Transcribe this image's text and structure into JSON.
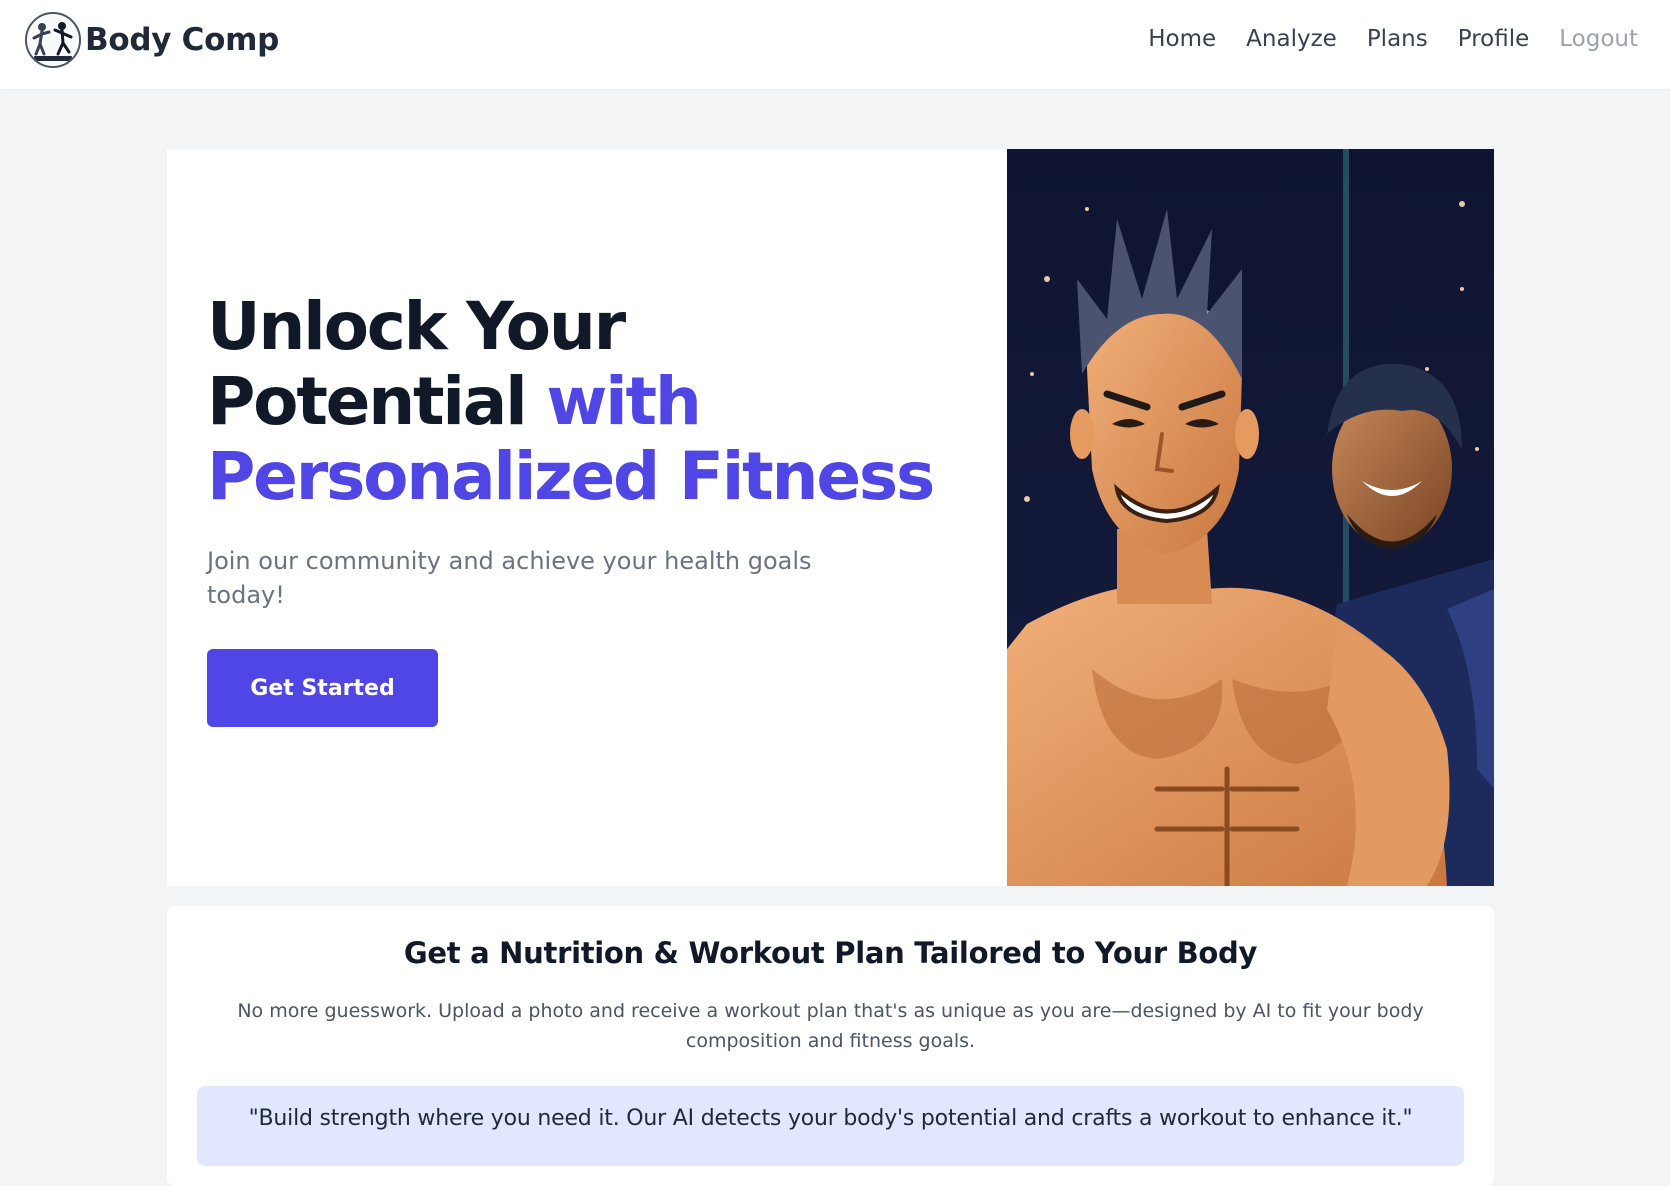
{
  "header": {
    "brand": "Body Comp",
    "nav": [
      {
        "label": "Home"
      },
      {
        "label": "Analyze"
      },
      {
        "label": "Plans"
      },
      {
        "label": "Profile"
      },
      {
        "label": "Logout"
      }
    ]
  },
  "hero": {
    "title_line1": "Unlock Your",
    "title_line2": "Potential",
    "title_accent1": "with",
    "title_accent2": "Personalized Fitness",
    "subtitle": "Join our community and achieve your health goals today!",
    "cta_label": "Get Started"
  },
  "features": {
    "title": "Get a Nutrition & Workout Plan Tailored to Your Body",
    "description": "No more guesswork. Upload a photo and receive a workout plan that's as unique as you are—designed by AI to fit your body composition and fitness goals.",
    "quote": "\"Build strength where you need it. Our AI detects your body's potential and crafts a workout to enhance it.\""
  },
  "colors": {
    "accent": "#4f46e5",
    "page_bg": "#f3f4f6",
    "quote_bg": "#e0e7ff"
  },
  "icons": {
    "logo": "fitness-athletes-logo-icon",
    "hero_image": "anime-muscular-men-illustration"
  }
}
